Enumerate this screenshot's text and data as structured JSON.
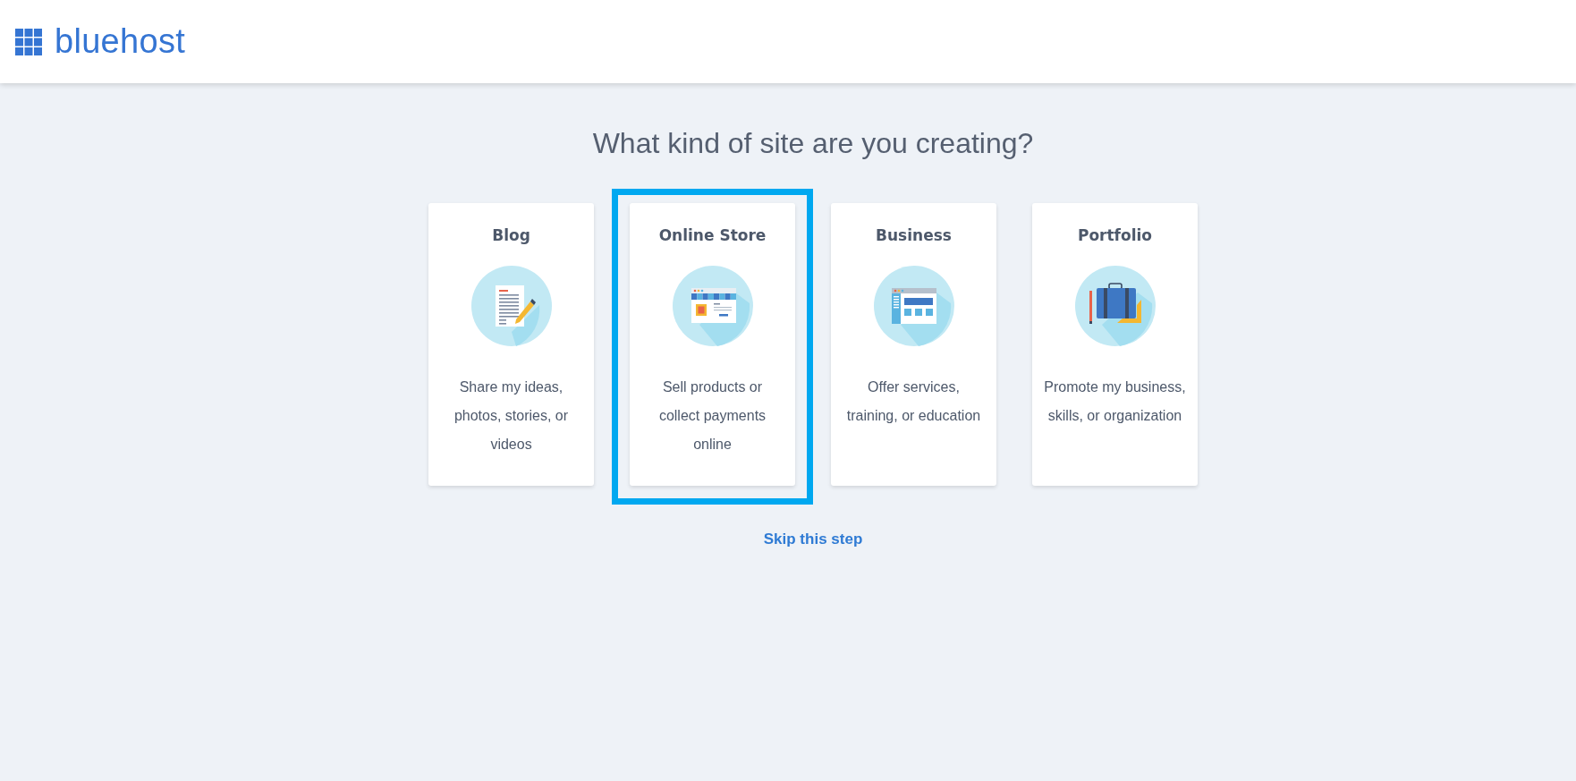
{
  "header": {
    "logo": "bluehost"
  },
  "heading": "What kind of site are you creating?",
  "cards": [
    {
      "title": "Blog",
      "description": "Share my ideas, photos, stories, or videos",
      "selected": false
    },
    {
      "title": "Online Store",
      "description": "Sell products or collect payments online",
      "selected": true
    },
    {
      "title": "Business",
      "description": "Offer services, training, or education",
      "selected": false
    },
    {
      "title": "Portfolio",
      "description": "Promote my business, skills, or organization",
      "selected": false
    }
  ],
  "skip_link": "Skip this step"
}
